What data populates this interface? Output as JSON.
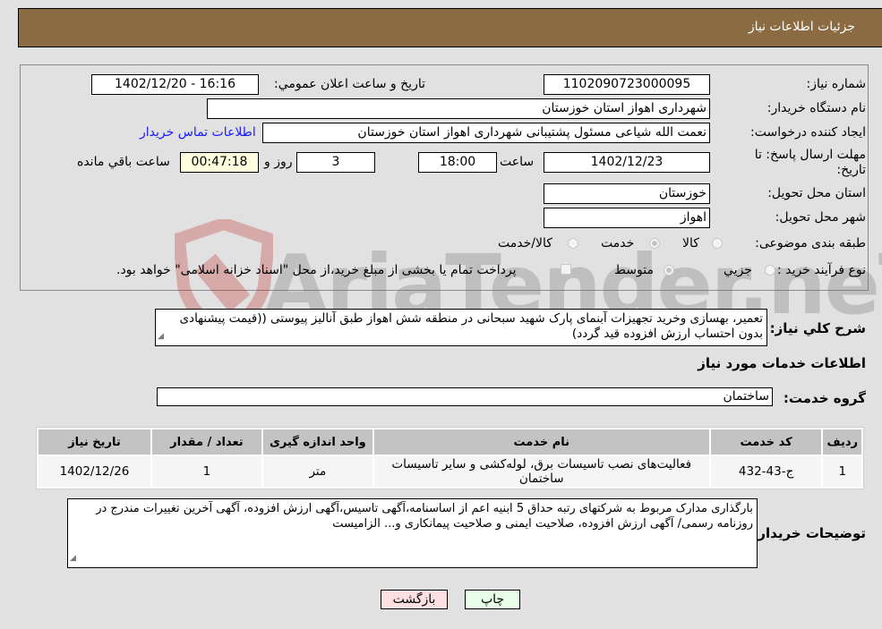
{
  "header": {
    "title": "جزئيات اطلاعات نياز"
  },
  "form": {
    "need_number_label": "شماره نياز:",
    "need_number": "1102090723000095",
    "announce_label": "تاريخ و ساعت اعلان عمومي:",
    "announce_value": "1402/12/20 - 16:16",
    "buyer_org_label": "نام دستگاه خريدار:",
    "buyer_org": "شهرداری اهواز استان خوزستان",
    "requester_label": "ايجاد کننده درخواست:",
    "requester": "نعمت الله شیاعی مسئول پشتیبانی شهرداری اهواز استان خوزستان",
    "contact_link": "اطلاعات تماس خريدار",
    "deadline_label_1": "مهلت ارسال پاسخ: تا",
    "deadline_label_2": "تاريخ:",
    "deadline_date": "1402/12/23",
    "time_label": "ساعت",
    "deadline_time": "18:00",
    "days_value": "3",
    "days_label": "روز و",
    "remaining_time": "00:47:18",
    "remaining_label": "ساعت باقي مانده",
    "province_label": "استان محل تحويل:",
    "province": "خوزستان",
    "city_label": "شهر محل تحويل:",
    "city": "اهواز",
    "category_label": "طبقه بندی موضوعی:",
    "category_options": [
      {
        "label": "کالا",
        "selected": false
      },
      {
        "label": "خدمت",
        "selected": true
      },
      {
        "label": "کالا/خدمت",
        "selected": false
      }
    ],
    "process_label": "نوع فرآيند خريد :",
    "process_options": [
      {
        "label": "جزيي",
        "selected": false
      },
      {
        "label": "متوسط",
        "selected": true
      }
    ],
    "treasury_checkbox_label": "پرداخت تمام يا بخشی از مبلغ خريد،از محل \"اسناد خزانه اسلامی\" خواهد بود.",
    "treasury_checked": false
  },
  "description": {
    "label": "شرح كلي نياز:",
    "text": "تعمیر، بهسازی وخرید تجهیزات آبنمای پارک شهید سبحانی در منطقه شش اهواز طبق آنالیز پیوستی ((قیمت پیشنهادی بدون احتساب ارزش افزوده قید گردد)"
  },
  "services_section": {
    "title": "اطلاعات خدمات مورد نياز",
    "group_label": "گروه خدمت:",
    "group_value": "ساختمان"
  },
  "table": {
    "headers": [
      "رديف",
      "كد خدمت",
      "نام خدمت",
      "واحد اندازه گيری",
      "تعداد / مقدار",
      "تاريخ نياز"
    ],
    "rows": [
      [
        "1",
        "ج-43-432",
        "فعالیت‌های نصب تاسیسات برق، لوله‌کشی و سایر تاسیسات ساختمان",
        "متر",
        "1",
        "1402/12/26"
      ]
    ]
  },
  "buyer_notes": {
    "label": "توضيحات خريدار:",
    "text": "بارگذاری مدارک مربوط به شرکتهای رتبه حداق 5 ابنیه اعم از اساسنامه،آگهی تاسیس،آگهی ارزش افزوده، آگهی آخرین تغییرات مندرج در روزنامه رسمی/  آگهی ارزش افزوده، صلاحیت ایمنی و صلاحیت پیمانکاری و... الزامیست"
  },
  "buttons": {
    "print": "چاپ",
    "back": "بازگشت"
  },
  "watermark": {
    "text": "AriaTender.neT"
  },
  "colors": {
    "header_bg": "#8b6b42",
    "page_bg": "#e1e1e1",
    "print_btn_bg": "#e8ffe8",
    "back_btn_bg": "#ffe0e0",
    "remaining_bg": "#ffffe0",
    "link": "#1a1aff"
  }
}
